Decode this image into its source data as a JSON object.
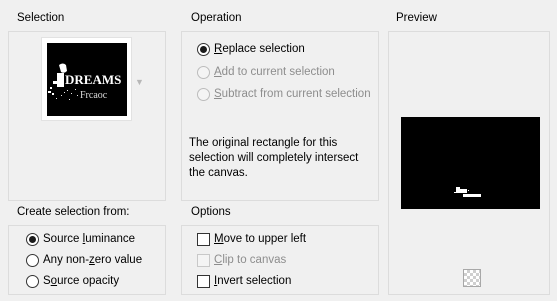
{
  "selection": {
    "title": "Selection",
    "thumbnail_text": "DREAMS"
  },
  "operation": {
    "title": "Operation",
    "options": [
      {
        "pre": "",
        "u": "R",
        "post": "eplace selection",
        "checked": true,
        "disabled": false
      },
      {
        "pre": "",
        "u": "A",
        "post": "dd to current selection",
        "checked": false,
        "disabled": true
      },
      {
        "pre": "",
        "u": "S",
        "post": "ubtract from current selection",
        "checked": false,
        "disabled": true
      }
    ],
    "info_text": "The original rectangle for this selection will completely intersect the canvas."
  },
  "preview": {
    "title": "Preview"
  },
  "create_from": {
    "title": "Create selection from:",
    "options": [
      {
        "pre": "Source ",
        "u": "l",
        "post": "uminance",
        "checked": true
      },
      {
        "pre": "Any non-",
        "u": "z",
        "post": "ero value",
        "checked": false
      },
      {
        "pre": "S",
        "u": "o",
        "post": "urce opacity",
        "checked": false
      }
    ]
  },
  "options": {
    "title": "Options",
    "items": [
      {
        "pre": "",
        "u": "M",
        "post": "ove to upper left",
        "checked": false,
        "disabled": false
      },
      {
        "pre": "",
        "u": "C",
        "post": "lip to canvas",
        "checked": false,
        "disabled": true
      },
      {
        "pre": "",
        "u": "I",
        "post": "nvert selection",
        "checked": false,
        "disabled": false
      }
    ]
  },
  "colors": {
    "panel_border": "#dcdcdc",
    "background": "#f0f0f0",
    "disabled_text": "#8d8d8d"
  }
}
